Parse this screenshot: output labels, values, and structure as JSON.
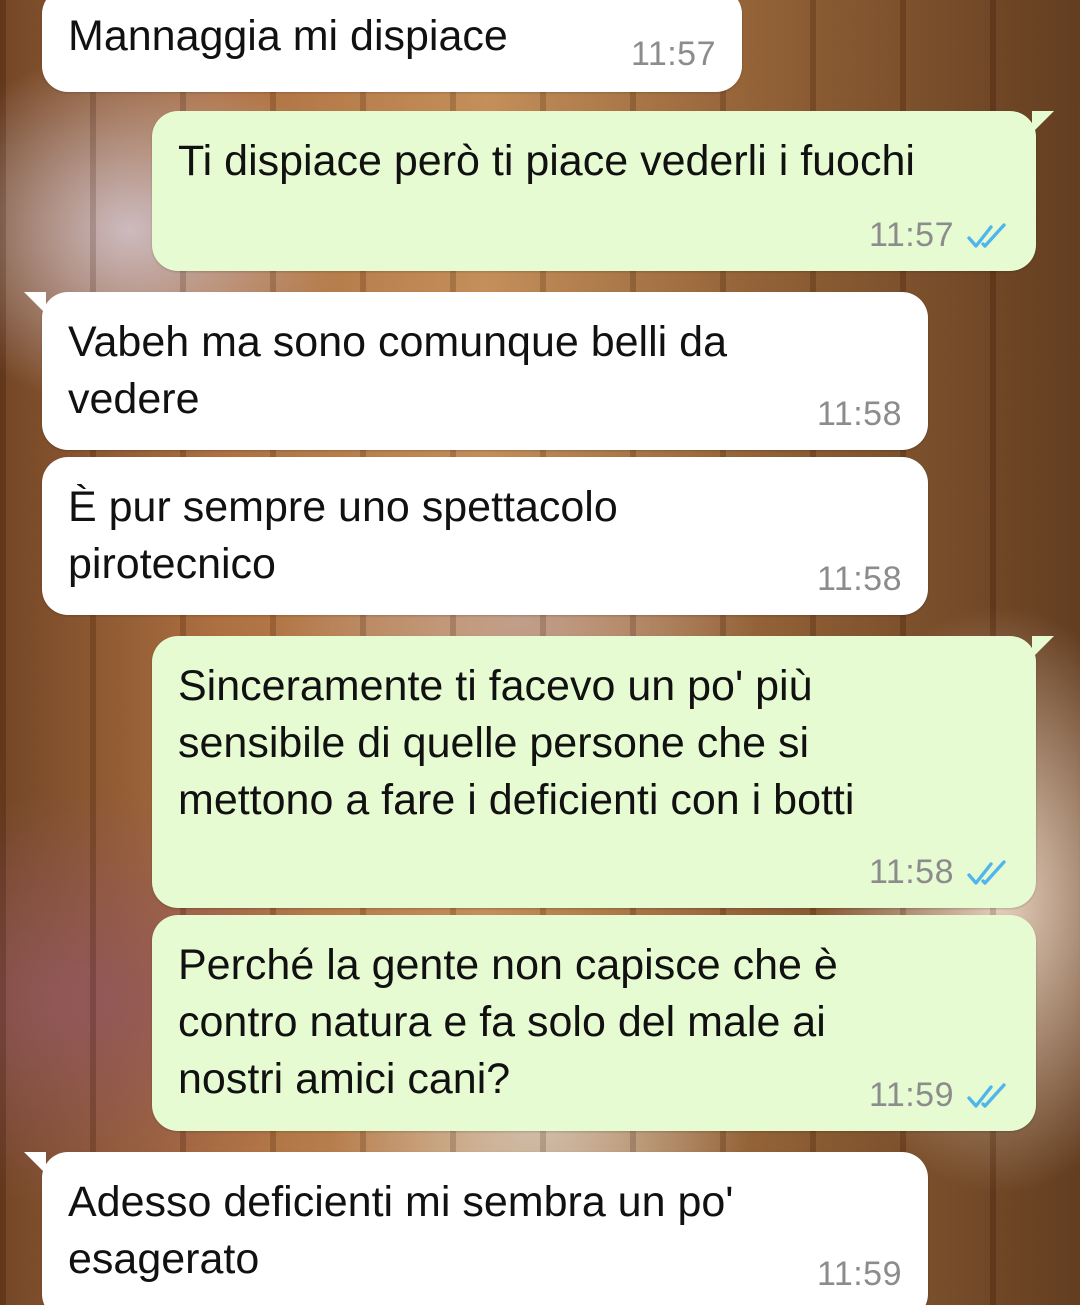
{
  "chat": {
    "messages": [
      {
        "direction": "incoming",
        "text": "Mannaggia mi dispiace",
        "time": "11:57"
      },
      {
        "direction": "outgoing",
        "text": "Ti dispiace però ti piace vederli i fuochi",
        "time": "11:57",
        "status": "read"
      },
      {
        "direction": "incoming",
        "text": "Vabeh ma sono comunque belli da\nvedere",
        "time": "11:58"
      },
      {
        "direction": "incoming",
        "text": "È pur sempre uno spettacolo\npirotecnico",
        "time": "11:58"
      },
      {
        "direction": "outgoing",
        "text": "Sinceramente ti facevo un po' più\nsensibile di quelle persone che si\nmettono a fare i deficienti con i botti",
        "time": "11:58",
        "status": "read"
      },
      {
        "direction": "outgoing",
        "text": "Perché la gente non capisce che è\ncontro natura e fa solo del male ai\nnostri amici cani?",
        "time": "11:59",
        "status": "read"
      },
      {
        "direction": "incoming",
        "text": "Adesso deficienti mi sembra un po'\nesagerato",
        "time": "11:59"
      }
    ]
  },
  "colors": {
    "incoming_bubble": "#ffffff",
    "outgoing_bubble": "#e7fbd3",
    "read_ticks": "#4fb6ec",
    "timestamp": "#8c8c8c"
  },
  "icons": {
    "read_receipt": "double-check-icon"
  }
}
